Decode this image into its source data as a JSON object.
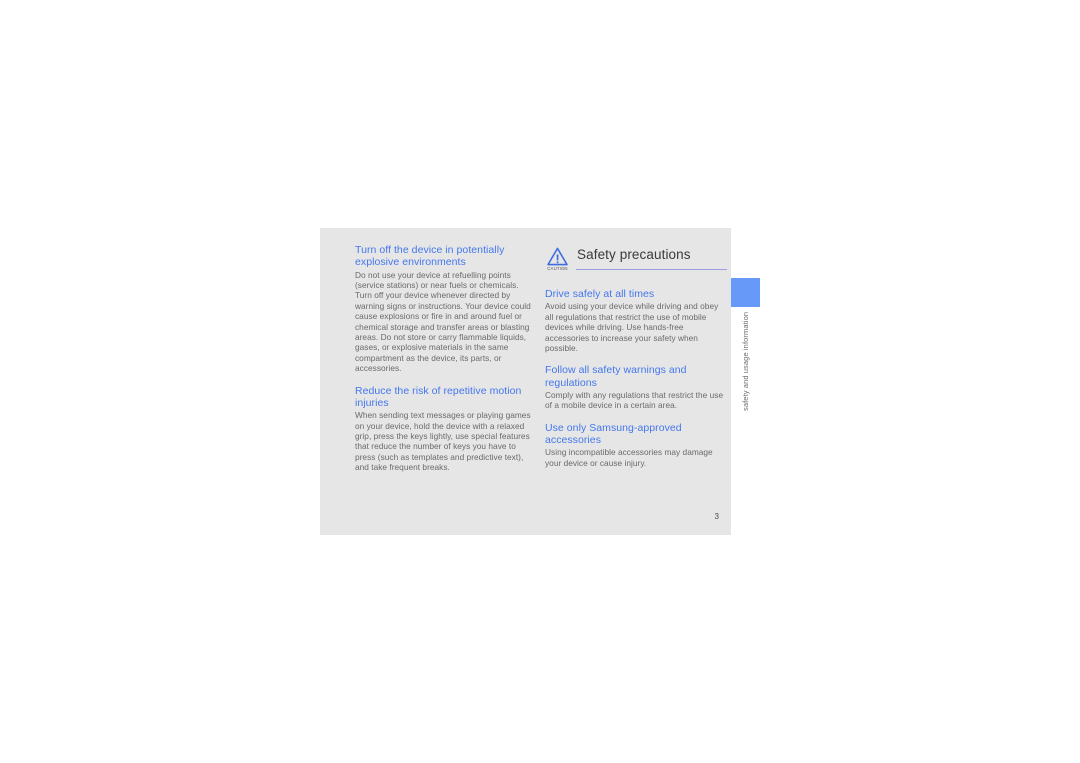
{
  "document": {
    "page_number": "3",
    "thumb_tab_label": "safety and usage information",
    "colors": {
      "page_background": "#e6e6e6",
      "heading_blue": "#4477ee",
      "tab_blue": "#6699f8",
      "body_gray": "#6a6a6a",
      "rule_lavender": "#9a9ee0",
      "title_dark": "#3a3a3a"
    }
  },
  "left_column": {
    "blocks": [
      {
        "heading": "Turn off the device in potentially explosive environments",
        "body": "Do not use your device at refuelling points (service stations) or near fuels or chemicals. Turn off your device whenever directed by warning signs or instructions. Your device could cause explosions or fire in and around fuel or chemical storage and transfer areas or blasting areas. Do not store or carry flammable liquids, gases, or explosive materials in the same compartment as the device, its parts, or accessories."
      },
      {
        "heading": "Reduce the risk of repetitive motion injuries",
        "body": "When sending text messages or playing games on your device, hold the device with a relaxed grip, press the keys lightly, use special features that reduce the number of keys you have to press (such as templates and predictive text), and take frequent breaks."
      }
    ]
  },
  "right_column": {
    "section_title": "Safety precautions",
    "caution_icon_label": "CAUTION",
    "blocks": [
      {
        "heading": "Drive safely at all times",
        "body": "Avoid using your device while driving and obey all regulations that restrict the use of mobile devices while driving. Use hands-free accessories to increase your safety when possible."
      },
      {
        "heading": "Follow all safety warnings and regulations",
        "body": "Comply with any regulations that restrict the use of a mobile device in a certain area."
      },
      {
        "heading": "Use only Samsung-approved accessories",
        "body": "Using incompatible accessories may damage your device or cause injury."
      }
    ]
  }
}
